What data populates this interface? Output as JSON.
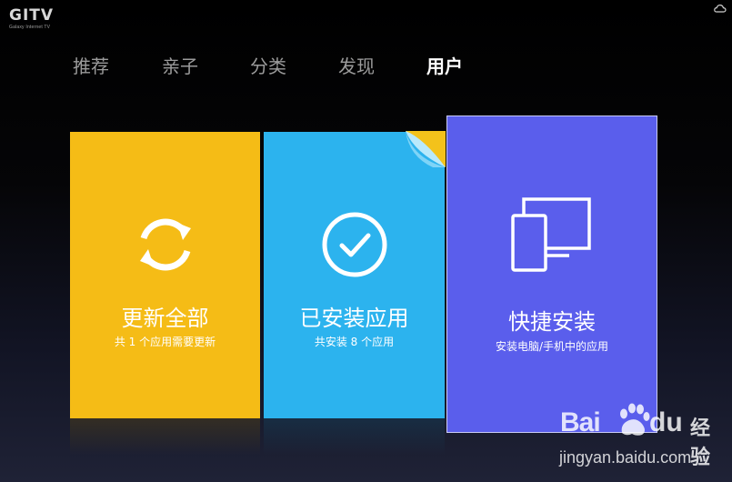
{
  "logo": {
    "brand": "GITV",
    "tagline": "Galaxy Internet TV"
  },
  "nav": {
    "tabs": [
      {
        "label": "推荐",
        "active": false
      },
      {
        "label": "亲子",
        "active": false
      },
      {
        "label": "分类",
        "active": false
      },
      {
        "label": "发现",
        "active": false
      },
      {
        "label": "用户",
        "active": true
      }
    ]
  },
  "cards": [
    {
      "title": "更新全部",
      "subtitle": "共 1 个应用需要更新",
      "icon": "refresh-icon",
      "color": "#f5bc16"
    },
    {
      "title": "已安装应用",
      "subtitle": "共安装 8 个应用",
      "icon": "check-circle-icon",
      "color": "#2cb3ee"
    },
    {
      "title": "快捷安装",
      "subtitle": "安装电脑/手机中的应用",
      "icon": "devices-icon",
      "color": "#5a5eec"
    }
  ],
  "watermark": {
    "brand_left": "Bai",
    "brand_right": "du",
    "product": "经验",
    "url": "jingyan.baidu.com"
  }
}
